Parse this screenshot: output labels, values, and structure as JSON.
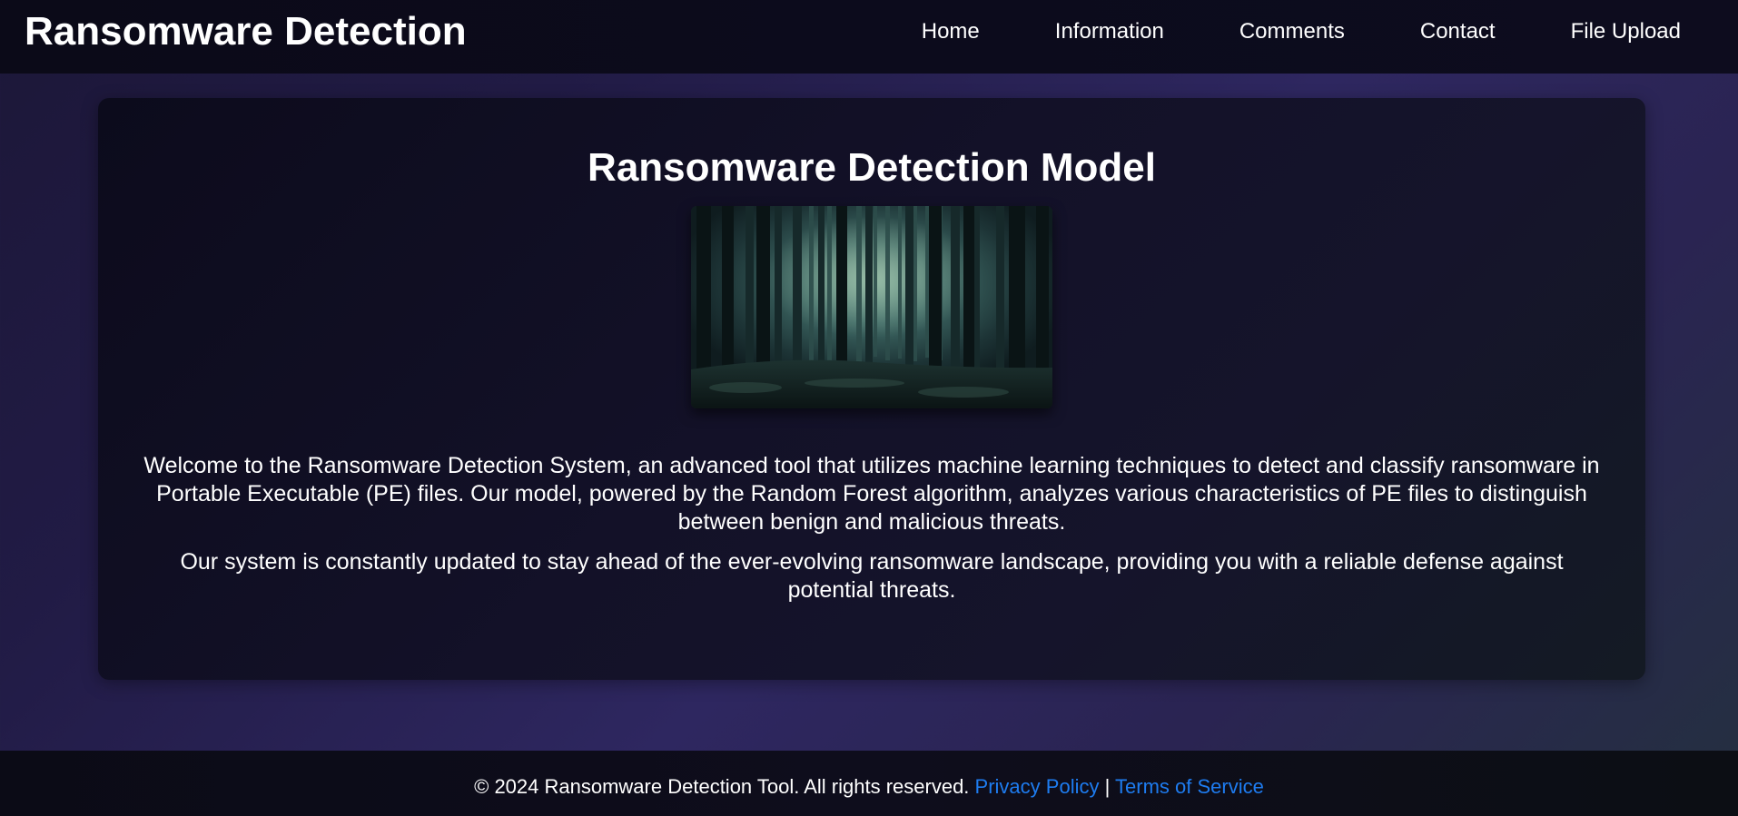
{
  "header": {
    "brand": "Ransomware Detection",
    "nav": [
      {
        "label": "Home"
      },
      {
        "label": "Information"
      },
      {
        "label": "Comments"
      },
      {
        "label": "Contact"
      },
      {
        "label": "File Upload"
      }
    ]
  },
  "main": {
    "title": "Ransomware Detection Model",
    "image_alt": "dark-forest-image",
    "paragraphs": [
      "Welcome to the Ransomware Detection System, an advanced tool that utilizes machine learning techniques to detect and classify ransomware in Portable Executable (PE) files. Our model, powered by the Random Forest algorithm, analyzes various characteristics of PE files to distinguish between benign and malicious threats.",
      "Our system is constantly updated to stay ahead of the ever-evolving ransomware landscape, providing you with a reliable defense against potential threats."
    ]
  },
  "footer": {
    "copyright": "© 2024 Ransomware Detection Tool. All rights reserved.",
    "privacy_label": "Privacy Policy",
    "separator": "|",
    "terms_label": "Terms of Service"
  },
  "colors": {
    "link": "#1e7cf0",
    "text": "#ffffff"
  }
}
